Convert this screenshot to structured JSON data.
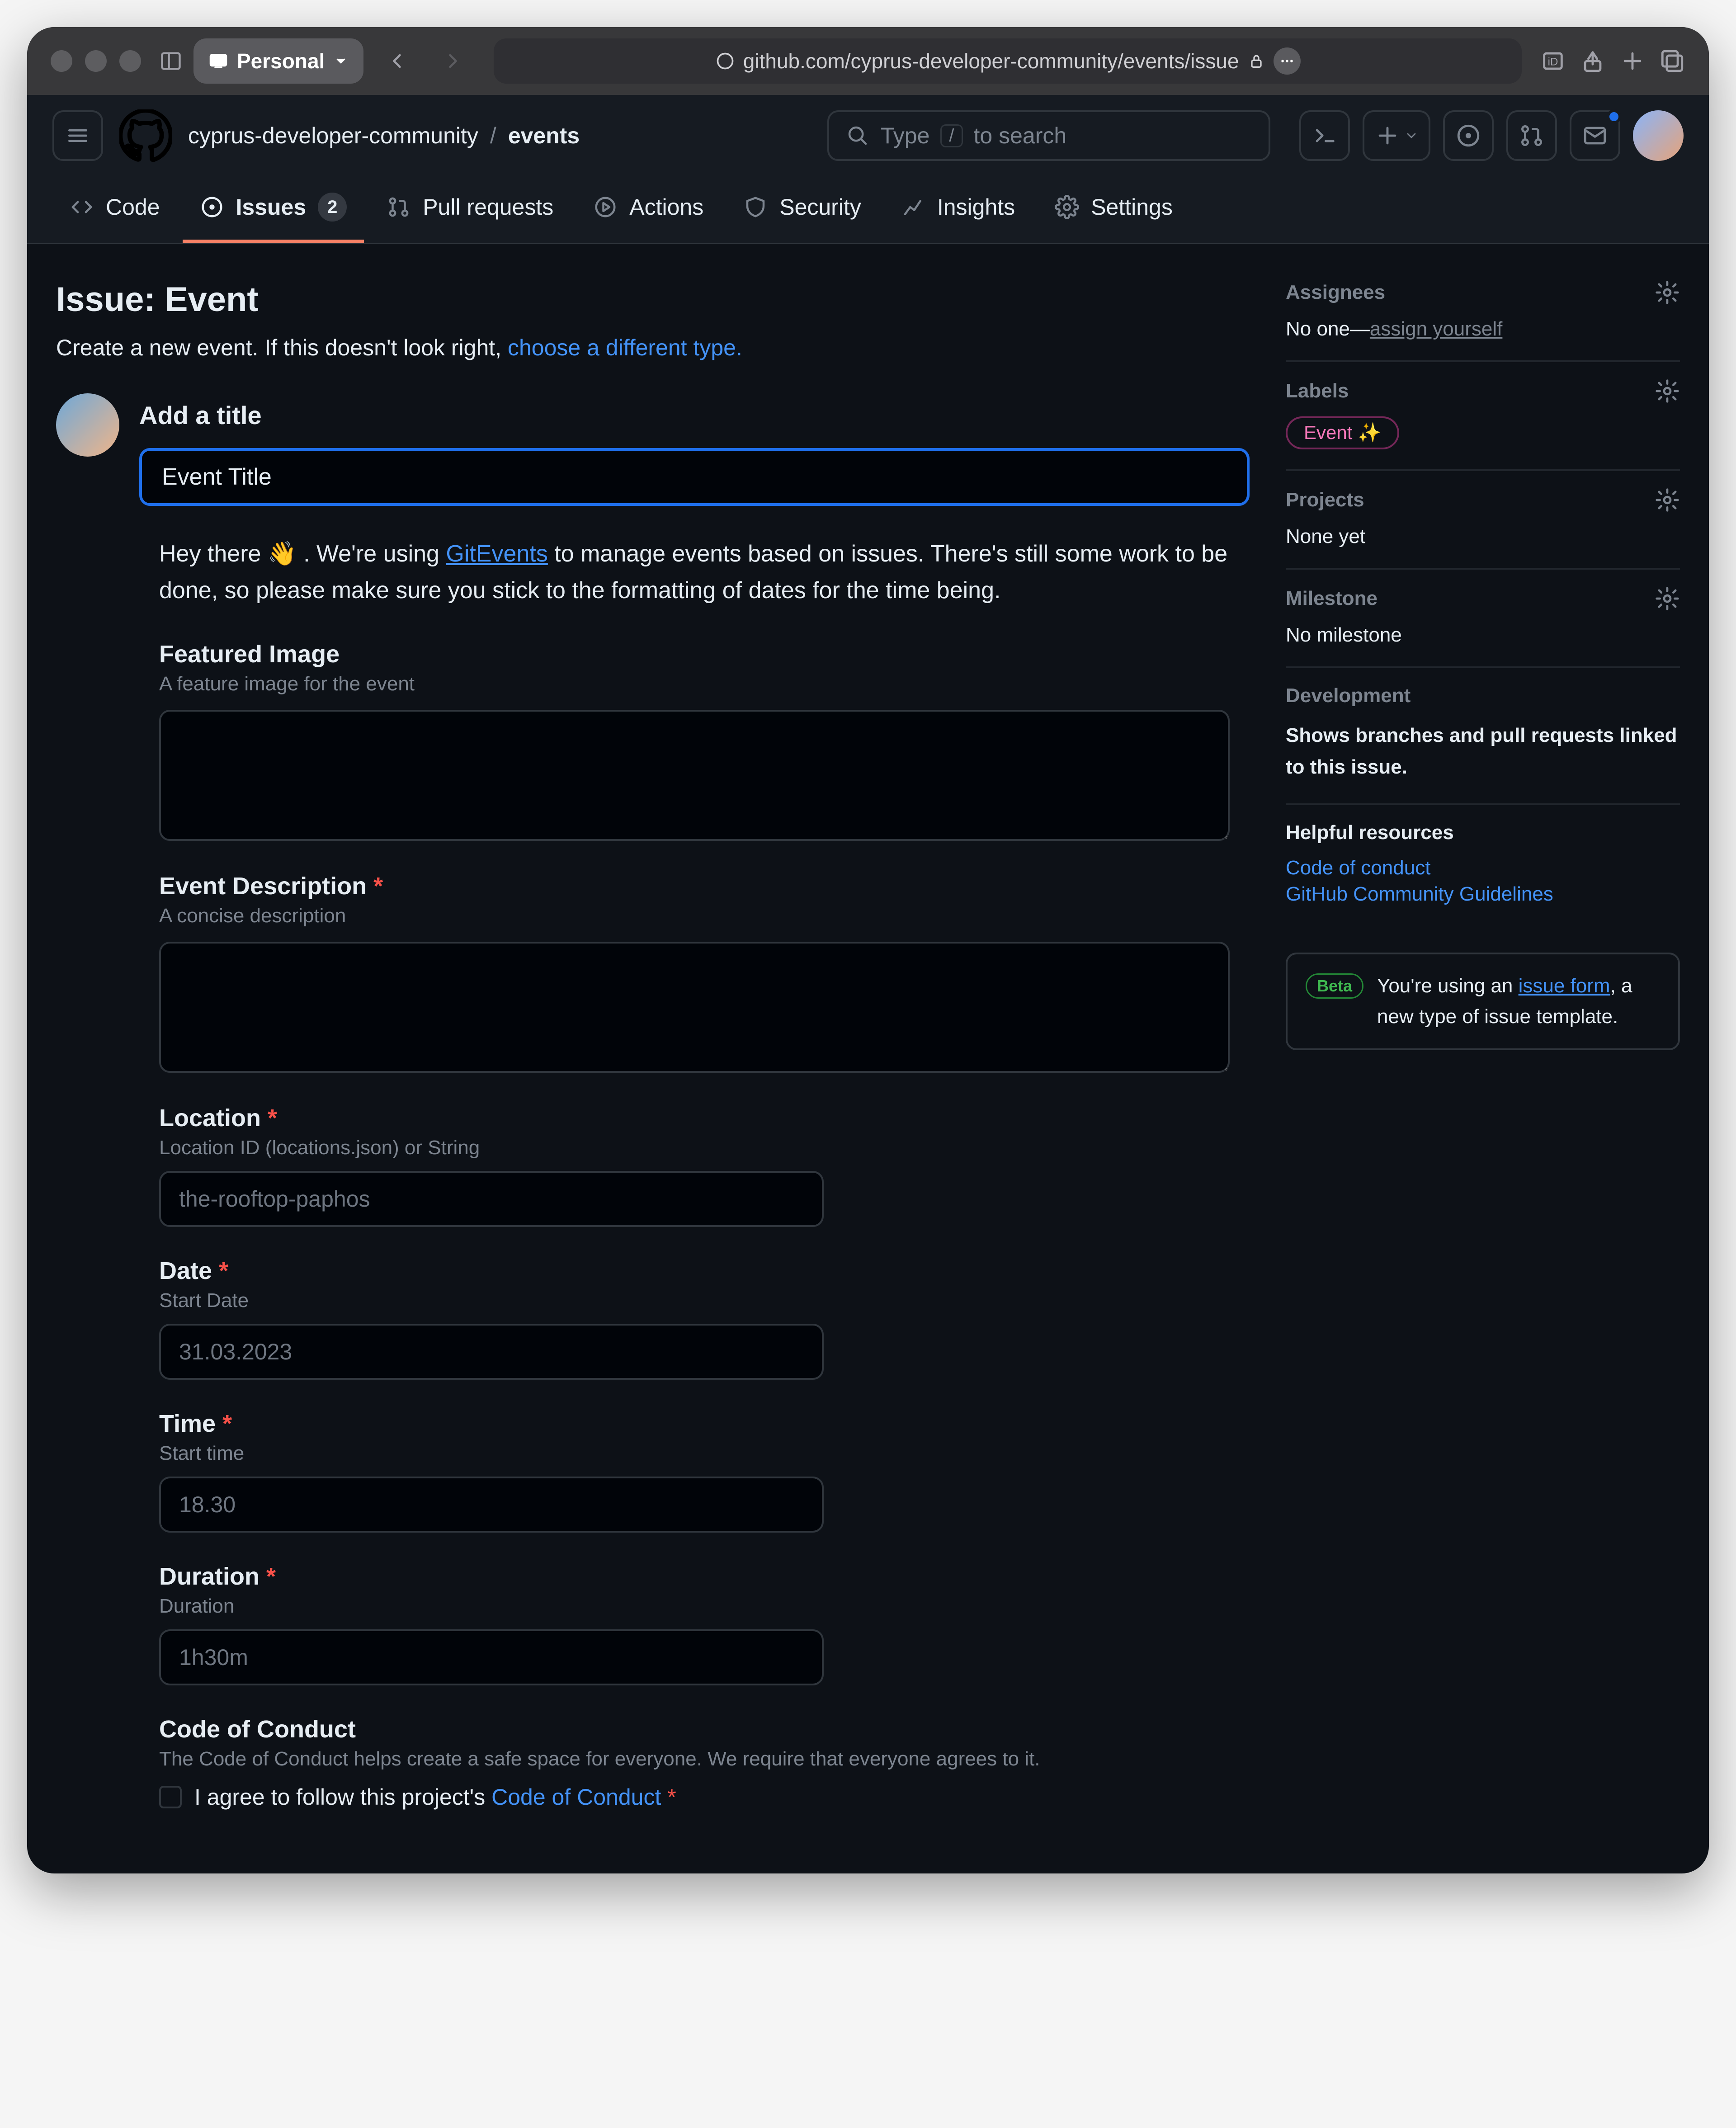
{
  "browser": {
    "profile_label": "Personal",
    "url": "github.com/cyprus-developer-community/events/issue"
  },
  "header": {
    "org": "cyprus-developer-community",
    "repo": "events",
    "search_prefix": "Type",
    "search_key": "/",
    "search_placeholder": "to search"
  },
  "tabs": {
    "code": "Code",
    "issues": "Issues",
    "issues_count": "2",
    "pulls": "Pull requests",
    "actions": "Actions",
    "security": "Security",
    "insights": "Insights",
    "settings": "Settings"
  },
  "page": {
    "title": "Issue: Event",
    "subtitle_pre": "Create a new event. If this doesn't look right, ",
    "subtitle_link": "choose a different type."
  },
  "form": {
    "title_label": "Add a title",
    "title_value": "Event Title",
    "intro_pre": "Hey there 👋 . We're using ",
    "intro_link": "GitEvents",
    "intro_post": " to manage events based on issues. There's still some work to be done, so please make sure you stick to the formatting of dates for the time being.",
    "featured_label": "Featured Image",
    "featured_desc": "A feature image for the event",
    "desc_label": "Event Description",
    "desc_desc": "A concise description",
    "location_label": "Location",
    "location_desc": "Location ID (locations.json) or String",
    "location_placeholder": "the-rooftop-paphos",
    "date_label": "Date",
    "date_desc": "Start Date",
    "date_placeholder": "31.03.2023",
    "time_label": "Time",
    "time_desc": "Start time",
    "time_placeholder": "18.30",
    "duration_label": "Duration",
    "duration_desc": "Duration",
    "duration_placeholder": "1h30m",
    "coc_label": "Code of Conduct",
    "coc_desc": "The Code of Conduct helps create a safe space for everyone. We require that everyone agrees to it.",
    "coc_check_pre": "I agree to follow this project's ",
    "coc_check_link": "Code of Conduct"
  },
  "sidebar": {
    "assignees_title": "Assignees",
    "assignees_none": "No one—",
    "assignees_self": "assign yourself",
    "labels_title": "Labels",
    "label_value": "Event ✨",
    "projects_title": "Projects",
    "projects_none": "None yet",
    "milestone_title": "Milestone",
    "milestone_none": "No milestone",
    "dev_title": "Development",
    "dev_text": "Shows branches and pull requests linked to this issue.",
    "resources_title": "Helpful resources",
    "res_coc": "Code of conduct",
    "res_guidelines": "GitHub Community Guidelines",
    "beta_badge": "Beta",
    "beta_pre": "You're using an ",
    "beta_link": "issue form",
    "beta_post": ", a new type of issue template."
  }
}
